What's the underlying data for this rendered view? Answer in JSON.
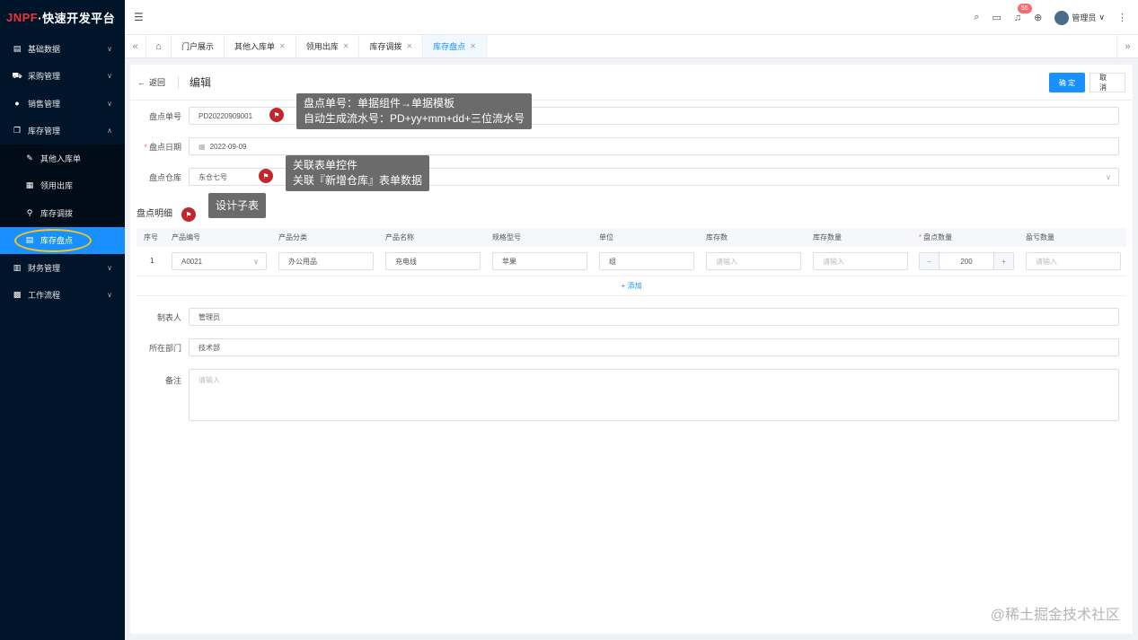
{
  "logo": {
    "brand": "JNPF",
    "name": "·快速开发平台"
  },
  "sidebar": {
    "items": [
      {
        "label": "基础数据",
        "icon": "document-icon",
        "expandable": true
      },
      {
        "label": "采购管理",
        "icon": "truck-icon",
        "expandable": true
      },
      {
        "label": "销售管理",
        "icon": "user-icon",
        "expandable": true
      },
      {
        "label": "库存管理",
        "icon": "inventory-icon",
        "expandable": true,
        "expanded": true
      },
      {
        "label": "其他入库单",
        "icon": "edit-icon",
        "sub": true
      },
      {
        "label": "领用出库",
        "icon": "table-icon",
        "sub": true
      },
      {
        "label": "库存调拨",
        "icon": "transfer-icon",
        "sub": true
      },
      {
        "label": "库存盘点",
        "icon": "list-icon",
        "sub": true,
        "active": true
      },
      {
        "label": "财务管理",
        "icon": "finance-icon",
        "expandable": true
      },
      {
        "label": "工作流程",
        "icon": "workflow-icon",
        "expandable": true
      }
    ]
  },
  "header": {
    "notification_count": "55",
    "user": "管理员"
  },
  "tabs": [
    {
      "label": "门户展示",
      "closable": false
    },
    {
      "label": "其他入库单",
      "closable": true
    },
    {
      "label": "领用出库",
      "closable": true
    },
    {
      "label": "库存调拨",
      "closable": true
    },
    {
      "label": "库存盘点",
      "closable": true,
      "active": true
    }
  ],
  "page": {
    "back": "返回",
    "title": "编辑",
    "confirm": "确 定",
    "cancel": "取 消"
  },
  "form": {
    "order_no": {
      "label": "盘点单号",
      "value": "PD20220909001"
    },
    "date": {
      "label": "盘点日期",
      "value": "2022-09-09",
      "required": true
    },
    "warehouse": {
      "label": "盘点仓库",
      "value": "东仓七号"
    },
    "detail_title": "盘点明细",
    "creator": {
      "label": "制表人",
      "value": "管理员"
    },
    "department": {
      "label": "所在部门",
      "value": "技术部"
    },
    "remark": {
      "label": "备注",
      "placeholder": "请输入"
    }
  },
  "table": {
    "columns": [
      "序号",
      "产品编号",
      "产品分类",
      "产品名称",
      "规格型号",
      "单位",
      "库存数",
      "库存数量",
      "盘点数量",
      "盈亏数量"
    ],
    "rows": [
      {
        "index": "1",
        "code": "A0021",
        "category": "办公用品",
        "name": "充电线",
        "spec": "苹果",
        "unit": "组",
        "stock_placeholder": "请输入",
        "stock_qty_placeholder": "请输入",
        "count": "200",
        "diff_placeholder": "请输入"
      }
    ],
    "add_label": "+ 添加"
  },
  "callouts": [
    {
      "line1": "盘点单号：单据组件→单据模板",
      "line2": "自动生成流水号：PD+yy+mm+dd+三位流水号"
    },
    {
      "line1": "关联表单控件",
      "line2": "关联『新增仓库』表单数据"
    },
    {
      "line1": "设计子表"
    }
  ],
  "watermark": "@稀土掘金技术社区"
}
